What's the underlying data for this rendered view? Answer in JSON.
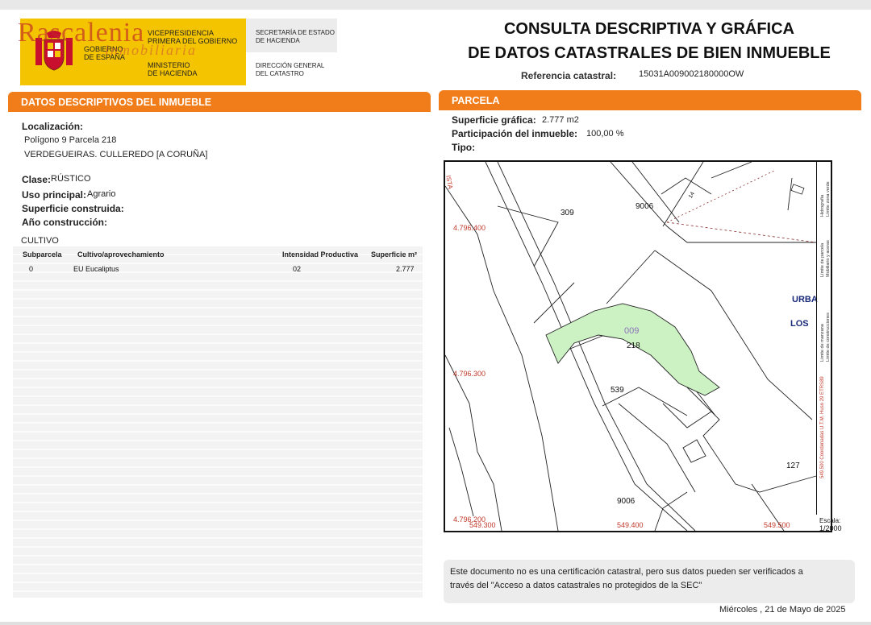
{
  "header": {
    "gov_line1": "Gobierno",
    "gov_line2": "de España",
    "vice_line1": "Vicepresidencia",
    "vice_line2": "Primera del Gobierno",
    "min_line1": "Ministerio",
    "min_line2": "de Hacienda",
    "sec_line1": "Secretaría de Estado",
    "sec_line2": "de Hacienda",
    "dir_line1": "Dirección General",
    "dir_line2": "del Catastro",
    "watermark_main": "Rascalenia",
    "watermark_sub": "inmobiliaria",
    "title_line1": "CONSULTA DESCRIPTIVA Y GRÁFICA",
    "title_line2": "DE DATOS CATASTRALES DE BIEN INMUEBLE",
    "ref_label": "Referencia catastral:",
    "ref_value": "15031A009002180000OW"
  },
  "left": {
    "section_title": "DATOS DESCRIPTIVOS DEL INMUEBLE",
    "localizacion_label": "Localización:",
    "localizacion_line1": "Polígono 9 Parcela 218",
    "localizacion_line2": "VERDEGUEIRAS. CULLEREDO [A CORUÑA]",
    "clase_label": "Clase:",
    "clase_value": "RÚSTICO",
    "uso_label": "Uso principal:",
    "uso_value": "Agrario",
    "superficie_label": "Superficie construida:",
    "anio_label": "Año construcción:",
    "cultivo_title": "CULTIVO",
    "table": {
      "headers": [
        "Subparcela",
        "Cultivo/aprovechamiento",
        "Intensidad Productiva",
        "Superficie m²"
      ],
      "rows": [
        [
          "0",
          "EU Eucaliptus",
          "02",
          "2.777"
        ]
      ]
    }
  },
  "right": {
    "section_title": "PARCELA",
    "sup_grafica_label": "Superficie gráfica:",
    "sup_grafica_value": "2.777 m2",
    "participacion_label": "Participación del inmueble:",
    "participacion_value": "100,00 %",
    "tipo_label": "Tipo:",
    "map": {
      "y_labels": [
        "4.796.400",
        "4.796.300",
        "4.796.200"
      ],
      "x_labels": [
        "549.300",
        "549.400",
        "549.500"
      ],
      "parcel_labels": [
        "309",
        "9006",
        "009",
        "218",
        "539",
        "127",
        "9006"
      ],
      "road_label_top": "14",
      "side_text_top": "ISTA",
      "urba_label1": "URBA",
      "urba_label2": "LOS",
      "legend_items": [
        "Límite de parcela",
        "Mobiliario y aceras",
        "Hidrografía",
        "Límite zona verde",
        "Límite de manzana",
        "Límite de construcciones"
      ],
      "legend_coords": "549.500 Coordenadas U.T.M. Huso 29 ETRS89",
      "escala_label": "Escala:",
      "escala_value": "1/2000",
      "parcel_fill": "#ccf2c4"
    },
    "notice_line1": "Este documento no es una certificación catastral, pero sus datos pueden ser verificados a",
    "notice_line2": "través del \"Acceso a datos catastrales no protegidos de la SEC\"",
    "date": "Miércoles , 21 de Mayo de 2025"
  }
}
